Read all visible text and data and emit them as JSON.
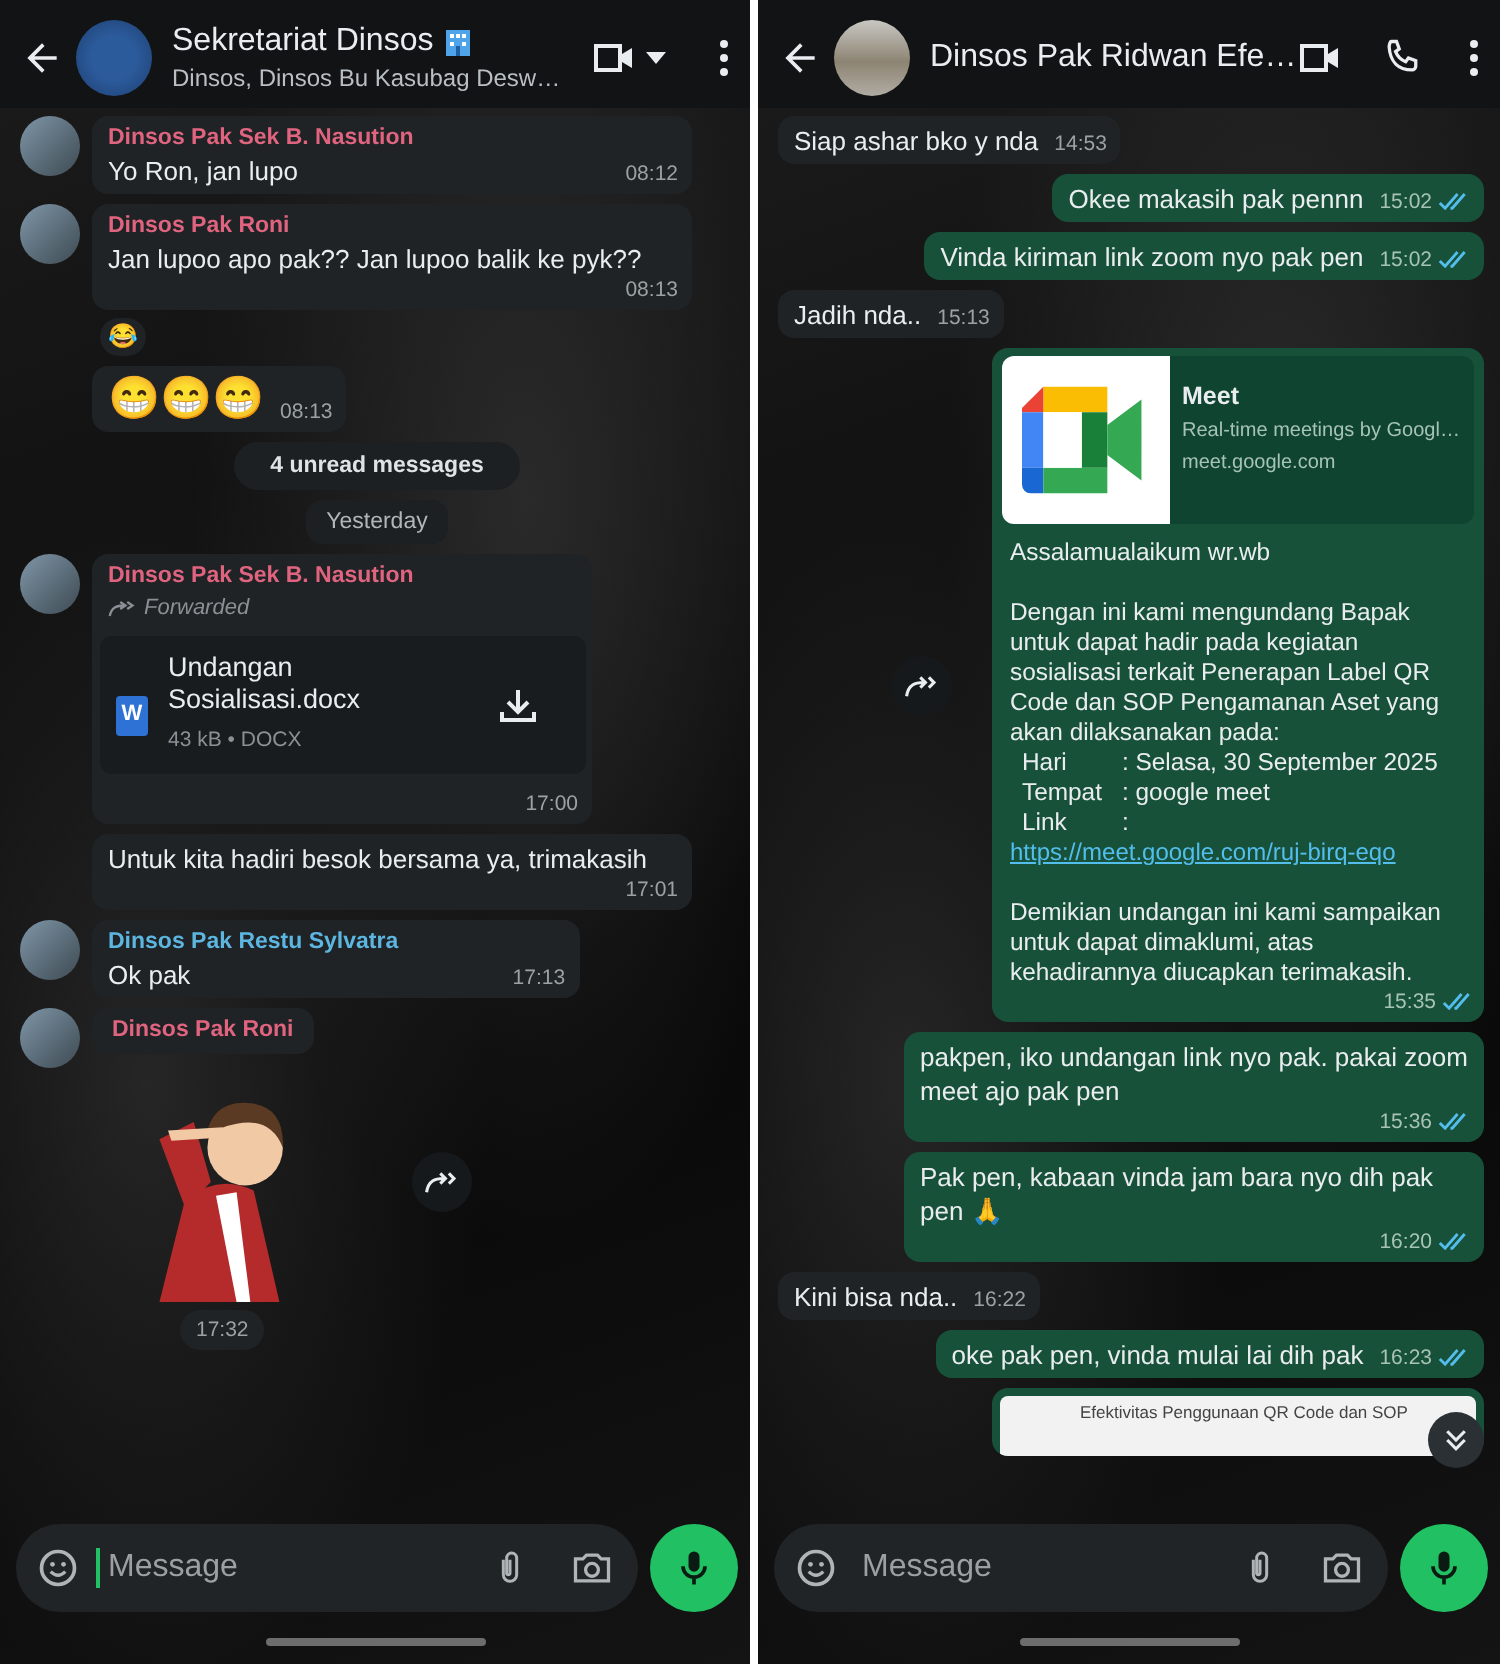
{
  "panels": [
    {
      "header": {
        "kind": "group",
        "title": "Sekretariat Dinsos",
        "title_badge": true,
        "subtitle": "Dinsos, Dinsos Bu Kasubag Desw…"
      },
      "messages": [
        {
          "kind": "text",
          "outgoing": false,
          "avatar": true,
          "sender": "Dinsos Pak Sek B. Nasution",
          "color": "#e0647f",
          "text": "Yo Ron, jan lupo",
          "time": "08:12"
        },
        {
          "kind": "text",
          "outgoing": false,
          "avatar": true,
          "sender": "Dinsos Pak Roni",
          "color": "#e0647f",
          "text": "Jan lupoo apo pak?? Jan lupoo balik ke pyk??",
          "time": "08:13",
          "reaction": "😂"
        },
        {
          "kind": "text",
          "outgoing": false,
          "avatar": false,
          "text": "😁😁😁",
          "time": "08:13",
          "big_emoji": true
        },
        {
          "kind": "unread",
          "text": "4 unread messages"
        },
        {
          "kind": "date",
          "text": "Yesterday"
        },
        {
          "kind": "document",
          "outgoing": false,
          "avatar": true,
          "sender": "Dinsos Pak Sek B. Nasution",
          "color": "#e0647f",
          "forwarded": true,
          "forward_label": "Forwarded",
          "file_icon_letter": "W",
          "file_name": "Undangan Sosialisasi.docx",
          "file_meta": "43 kB • DOCX",
          "time": "17:00"
        },
        {
          "kind": "text",
          "outgoing": false,
          "avatar": false,
          "text": "Untuk kita hadiri besok bersama ya, trimakasih",
          "time": "17:01"
        },
        {
          "kind": "text",
          "outgoing": false,
          "avatar": true,
          "sender": "Dinsos Pak Restu Sylvatra",
          "color": "#5cb6e0",
          "text": "Ok pak",
          "time": "17:13"
        },
        {
          "kind": "sticker",
          "outgoing": false,
          "avatar": true,
          "sender": "Dinsos Pak Roni",
          "color": "#e0647f",
          "time": "17:32",
          "forward_button": true
        }
      ],
      "composer": {
        "placeholder": "Message",
        "focused": true
      }
    },
    {
      "header": {
        "kind": "direct",
        "title": "Dinsos Pak Ridwan Efe…"
      },
      "messages": [
        {
          "kind": "text",
          "outgoing": false,
          "text": "Siap ashar bko y nda",
          "time": "14:53"
        },
        {
          "kind": "text",
          "outgoing": true,
          "text": "Okee makasih pak pennn",
          "time": "15:02",
          "read": true
        },
        {
          "kind": "text",
          "outgoing": true,
          "text": "Vinda kiriman link zoom nyo pak pen",
          "time": "15:02",
          "read": true
        },
        {
          "kind": "text",
          "outgoing": false,
          "text": "Jadih nda..",
          "time": "15:13"
        },
        {
          "kind": "link-preview",
          "outgoing": true,
          "forward_button": true,
          "preview": {
            "title": "Meet",
            "description": "Real-time meetings by Googl…",
            "domain": "meet.google.com"
          },
          "greeting": "Assalamualaikum wr.wb",
          "intro": "Dengan ini kami mengundang Bapak untuk dapat hadir pada kegiatan sosialisasi terkait Penerapan Label QR Code dan SOP Pengamanan Aset yang akan dilaksanakan pada:",
          "details": [
            {
              "label": "Hari",
              "value": ": Selasa, 30 September 2025"
            },
            {
              "label": "Tempat",
              "value": ": google meet"
            },
            {
              "label": "Link",
              "value": ":",
              "link": "https://meet.google.com/ruj-birq-eqo"
            }
          ],
          "closing": "Demikian undangan ini kami sampaikan untuk dapat dimaklumi, atas kehadirannya diucapkan terimakasih.",
          "time": "15:35",
          "read": true
        },
        {
          "kind": "text",
          "outgoing": true,
          "text": "pakpen, iko undangan link nyo pak. pakai zoom meet ajo pak pen",
          "time": "15:36",
          "read": true
        },
        {
          "kind": "text",
          "outgoing": true,
          "text": "Pak pen, kabaan vinda jam bara nyo dih pak pen 🙏",
          "time": "16:20",
          "read": true
        },
        {
          "kind": "text",
          "outgoing": false,
          "text": "Kini bisa nda..",
          "time": "16:22"
        },
        {
          "kind": "text",
          "outgoing": true,
          "text": "oke pak pen, vinda mulai lai dih pak",
          "time": "16:23",
          "read": true
        },
        {
          "kind": "doc-preview",
          "outgoing": true,
          "preview_text": "Efektivitas Penggunaan QR Code dan SOP"
        }
      ],
      "scroll_down_button": true,
      "composer": {
        "placeholder": "Message",
        "focused": false
      }
    }
  ]
}
